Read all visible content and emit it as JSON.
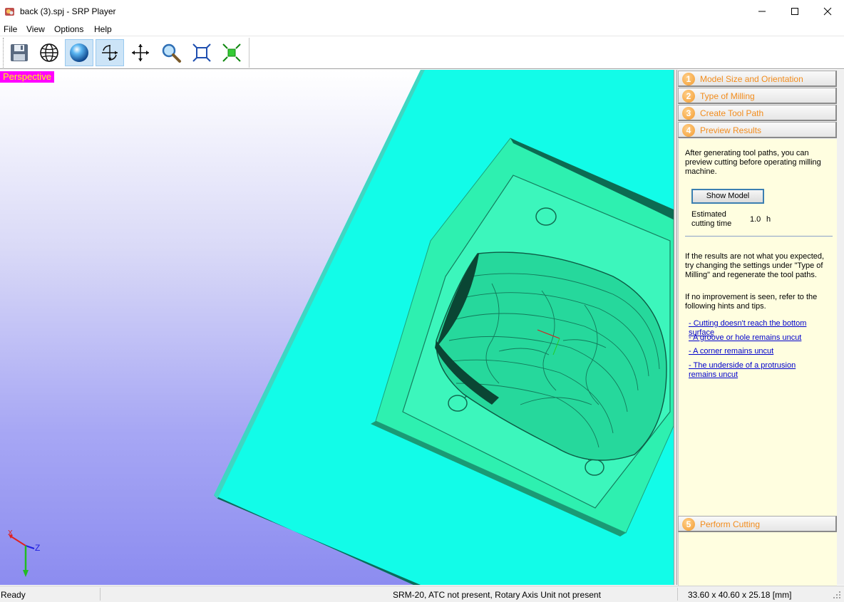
{
  "window": {
    "title": "back (3).spj - SRP Player",
    "icon": "srp-app-icon",
    "controls": [
      "minimize-icon",
      "maximize-icon",
      "close-icon"
    ]
  },
  "menu": [
    "File",
    "View",
    "Options",
    "Help"
  ],
  "toolbar": {
    "buttons": [
      {
        "icon": "save-icon",
        "active": false
      },
      {
        "icon": "wireframe-globe-icon",
        "active": false
      },
      {
        "icon": "shaded-sphere-icon",
        "active": true
      },
      {
        "icon": "rotate-icon",
        "active": true
      },
      {
        "icon": "pan-icon",
        "active": false
      },
      {
        "icon": "zoom-icon",
        "active": false
      },
      {
        "icon": "fit-to-window-icon",
        "active": false
      },
      {
        "icon": "fit-model-icon",
        "active": false
      }
    ]
  },
  "viewport": {
    "view_label": "Perspective",
    "axes": {
      "x": "X",
      "z": "Z"
    },
    "colors": {
      "label_bg": "#ff00ff",
      "label_fg": "#ffff00",
      "stock": "#12fce8",
      "model": "#2ef0b0"
    }
  },
  "panel": {
    "steps": [
      {
        "num": "1",
        "label": "Model Size and Orientation"
      },
      {
        "num": "2",
        "label": "Type of Milling"
      },
      {
        "num": "3",
        "label": "Create Tool Path"
      },
      {
        "num": "4",
        "label": "Preview Results"
      },
      {
        "num": "5",
        "label": "Perform Cutting"
      }
    ],
    "preview": {
      "intro": "After generating tool paths, you can preview cutting before operating milling machine.",
      "show_model_label": "Show Model",
      "estimated_label": "Estimated cutting time",
      "estimated_value": "1.0",
      "estimated_unit": "h",
      "hint1": "If the results are not what you expected, try changing the settings under \"Type of Milling\" and regenerate the tool paths.",
      "hint2": "If no improvement is seen, refer to the following hints and tips.",
      "links": [
        "- Cutting doesn't reach the bottom surface",
        "- A groove or hole remains uncut",
        "- A corner remains uncut",
        "- The underside of a protrusion remains uncut"
      ]
    }
  },
  "status": {
    "left": "Ready",
    "middle": "SRM-20, ATC not present, Rotary Axis Unit not present",
    "right": "33.60 x  40.60 x  25.18 [mm]"
  }
}
